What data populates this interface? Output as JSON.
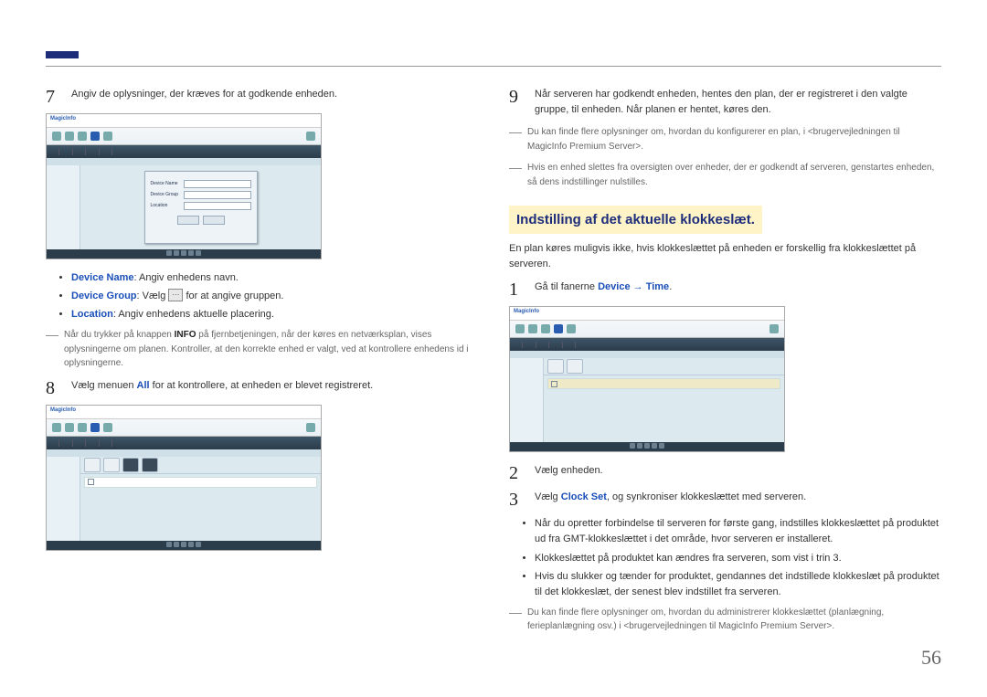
{
  "page_number": "56",
  "left": {
    "step7": {
      "num": "7",
      "text": "Angiv de oplysninger, der kræves for at godkende enheden."
    },
    "bullets": {
      "device_name_label": "Device Name",
      "device_name_text": ": Angiv enhedens navn.",
      "device_group_label": "Device Group",
      "device_group_text_pre": ": Vælg ",
      "device_group_text_post": " for at angive gruppen.",
      "location_label": "Location",
      "location_text": ": Angiv enhedens aktuelle placering."
    },
    "note1_pre": "Når du trykker på knappen ",
    "note1_bold": "INFO",
    "note1_post": " på fjernbetjeningen, når der køres en netværksplan, vises oplysningerne om planen. Kontroller, at den korrekte enhed er valgt, ved at kontrollere enhedens id i oplysningerne.",
    "step8": {
      "num": "8",
      "text_pre": "Vælg menuen ",
      "text_bold": "All",
      "text_post": " for at kontrollere, at enheden er blevet registreret."
    },
    "screenshot": {
      "brand": "MagicInfo",
      "dlg_device_name": "Device Name",
      "dlg_device_group": "Device Group",
      "dlg_location": "Location"
    }
  },
  "right": {
    "step9": {
      "num": "9",
      "text": "Når serveren har godkendt enheden, hentes den plan, der er registreret i den valgte gruppe, til enheden. Når planen er hentet, køres den."
    },
    "note_r1": "Du kan finde flere oplysninger om, hvordan du konfigurerer en plan, i <brugervejledningen til MagicInfo Premium Server>.",
    "note_r2": "Hvis en enhed slettes fra oversigten over enheder, der er godkendt af serveren, genstartes enheden, så dens indstillinger nulstilles.",
    "heading": "Indstilling af det aktuelle klokkeslæt.",
    "intro": "En plan køres muligvis ikke, hvis klokkeslættet på enheden er forskellig fra klokkeslættet på serveren.",
    "step1": {
      "num": "1",
      "text_pre": "Gå til fanerne ",
      "device": "Device",
      "arrow": " → ",
      "time": "Time",
      "text_post": "."
    },
    "step2": {
      "num": "2",
      "text": "Vælg enheden."
    },
    "step3": {
      "num": "3",
      "text_pre": "Vælg ",
      "clock_set": "Clock Set",
      "text_post": ", og synkroniser klokkeslættet med serveren."
    },
    "bullets": {
      "b1": "Når du opretter forbindelse til serveren for første gang, indstilles klokkeslættet på produktet ud fra GMT-klokkeslættet i det område, hvor serveren er installeret.",
      "b2": "Klokkeslættet på produktet kan ændres fra serveren, som vist i trin 3.",
      "b3": "Hvis du slukker og tænder for produktet, gendannes det indstillede klokkeslæt på produktet til det klokkeslæt, der senest blev indstillet fra serveren."
    },
    "note_end": "Du kan finde flere oplysninger om, hvordan du administrerer klokkeslættet (planlægning, ferieplanlægning osv.) i <brugervejledningen til MagicInfo Premium Server>."
  }
}
